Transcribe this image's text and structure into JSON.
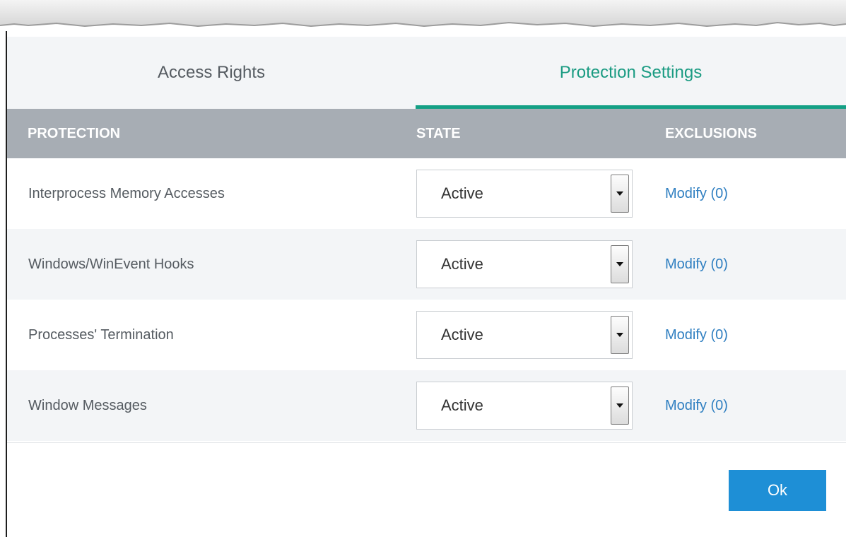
{
  "tabs": [
    {
      "label": "Access Rights",
      "active": false
    },
    {
      "label": "Protection Settings",
      "active": true
    }
  ],
  "table": {
    "headers": {
      "protection": "PROTECTION",
      "state": "STATE",
      "exclusions": "EXCLUSIONS"
    },
    "rows": [
      {
        "protection": "Interprocess Memory Accesses",
        "state": "Active",
        "exclusions": "Modify (0)"
      },
      {
        "protection": "Windows/WinEvent Hooks",
        "state": "Active",
        "exclusions": "Modify (0)"
      },
      {
        "protection": "Processes' Termination",
        "state": "Active",
        "exclusions": "Modify (0)"
      },
      {
        "protection": "Window Messages",
        "state": "Active",
        "exclusions": "Modify (0)"
      }
    ]
  },
  "footer": {
    "ok_label": "Ok"
  },
  "colors": {
    "accent": "#14a085",
    "header_bg": "#a7adb4",
    "link": "#2f7fc1",
    "ok_button": "#1e8fd6"
  },
  "icons": {
    "dropdown": "chevron-down-icon"
  }
}
